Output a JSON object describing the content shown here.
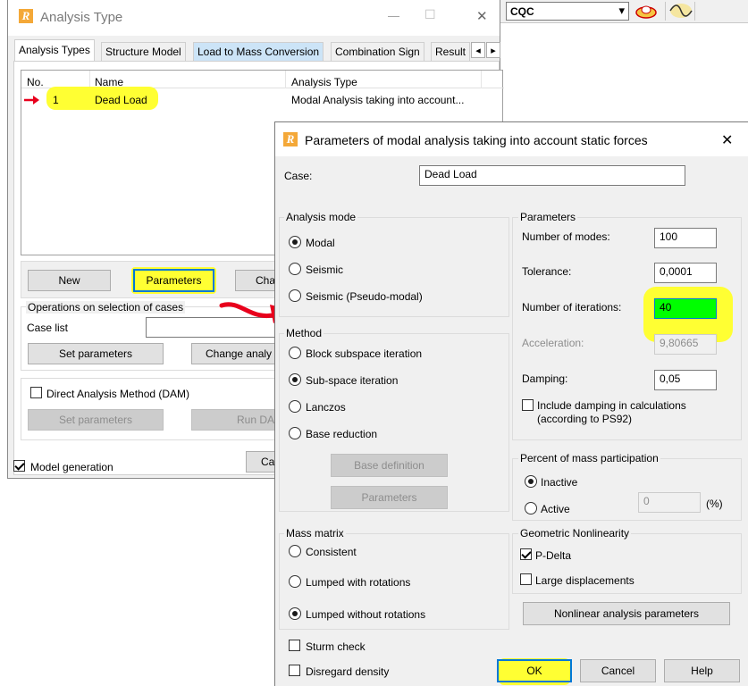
{
  "background_toolbar": {
    "combo_value": "CQC",
    "combo_arrow": "▾"
  },
  "analysis_window": {
    "title": "Analysis Type",
    "tabs": [
      "Analysis Types",
      "Structure Model",
      "Load to Mass Conversion",
      "Combination Sign",
      "Result"
    ],
    "tab_scroll_left": "◂",
    "tab_scroll_right": "▸",
    "table_headers": [
      "No.",
      "Name",
      "Analysis Type"
    ],
    "rows": [
      {
        "no": "1",
        "name": "Dead Load",
        "type": "Modal Analysis taking into account..."
      }
    ],
    "buttons": {
      "new": "New",
      "parameters": "Parameters",
      "change": "Cha"
    },
    "operations_legend": "Operations on selection of cases",
    "case_list_label": "Case list",
    "set_parameters": "Set parameters",
    "change_analysis": "Change analy",
    "dam_label": "Direct Analysis Method (DAM)",
    "dam_set_parameters": "Set parameters",
    "dam_run": "Run DA",
    "model_generation": "Model generation",
    "close_partial": "Ca",
    "minimize": "—",
    "maximize": "☐",
    "close": "✕"
  },
  "dialog": {
    "title": "Parameters of modal analysis taking into account static forces",
    "close": "✕",
    "case_label": "Case:",
    "case_value": "Dead Load",
    "analysis_mode": {
      "legend": "Analysis mode",
      "options": [
        "Modal",
        "Seismic",
        "Seismic (Pseudo-modal)"
      ],
      "selected": "Modal"
    },
    "method": {
      "legend": "Method",
      "options": [
        "Block subspace iteration",
        "Sub-space iteration",
        "Lanczos",
        "Base reduction"
      ],
      "selected": "Sub-space iteration",
      "base_definition": "Base definition",
      "parameters": "Parameters"
    },
    "mass_matrix": {
      "legend": "Mass matrix",
      "options": [
        "Consistent",
        "Lumped with rotations",
        "Lumped without rotations"
      ],
      "selected": "Lumped without rotations"
    },
    "sturm_check": "Sturm check",
    "disregard_density": "Disregard density",
    "parameters": {
      "legend": "Parameters",
      "modes_label": "Number of modes:",
      "modes_value": "100",
      "tolerance_label": "Tolerance:",
      "tolerance_value": "0,0001",
      "iterations_label": "Number of iterations:",
      "iterations_value": "40",
      "acceleration_label": "Acceleration:",
      "acceleration_value": "9,80665",
      "damping_label": "Damping:",
      "damping_value": "0,05",
      "include_damping": "Include damping in calculations",
      "include_damping_2": "(according to PS92)"
    },
    "mass_participation": {
      "legend": "Percent of mass participation",
      "inactive": "Inactive",
      "active": "Active",
      "value": "0",
      "unit": "(%)"
    },
    "geometric": {
      "legend": "Geometric Nonlinearity",
      "pdelta": "P-Delta",
      "large_displacements": "Large displacements"
    },
    "nonlinear_button": "Nonlinear analysis parameters",
    "ok": "OK",
    "cancel": "Cancel",
    "help": "Help"
  },
  "colors": {
    "highlight": "#ffff33",
    "green_field": "#00ff00",
    "annotation_red": "#e8001c",
    "tab_active_bg": "#cce4f7"
  }
}
